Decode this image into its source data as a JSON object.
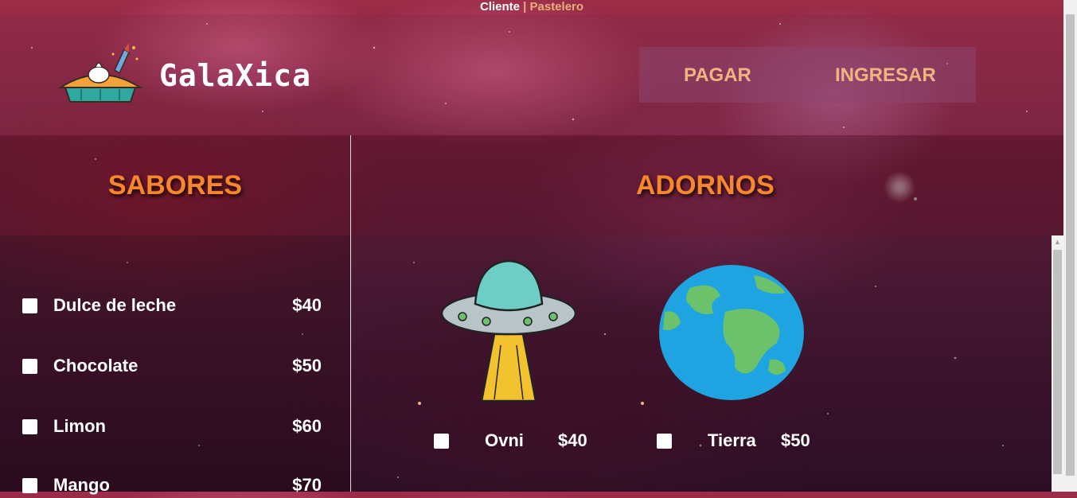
{
  "topbar": {
    "cliente": "Cliente",
    "separator": "|",
    "pastelero": "Pastelero"
  },
  "header": {
    "brand": "GalaXica",
    "nav": {
      "pagar": "PAGAR",
      "ingresar": "INGRESAR"
    }
  },
  "sabores": {
    "title": "SABORES",
    "items": [
      {
        "name": "Dulce de leche",
        "price": "$40"
      },
      {
        "name": "Chocolate",
        "price": "$50"
      },
      {
        "name": "Limon",
        "price": "$60"
      },
      {
        "name": "Mango",
        "price": "$70"
      }
    ]
  },
  "adornos": {
    "title": "ADORNOS",
    "items": [
      {
        "name": "Ovni",
        "price": "$40",
        "icon": "ufo-icon"
      },
      {
        "name": "Tierra",
        "price": "$50",
        "icon": "earth-icon"
      }
    ]
  },
  "colors": {
    "accent": "#f7872a",
    "nav_text": "#f0b483"
  }
}
